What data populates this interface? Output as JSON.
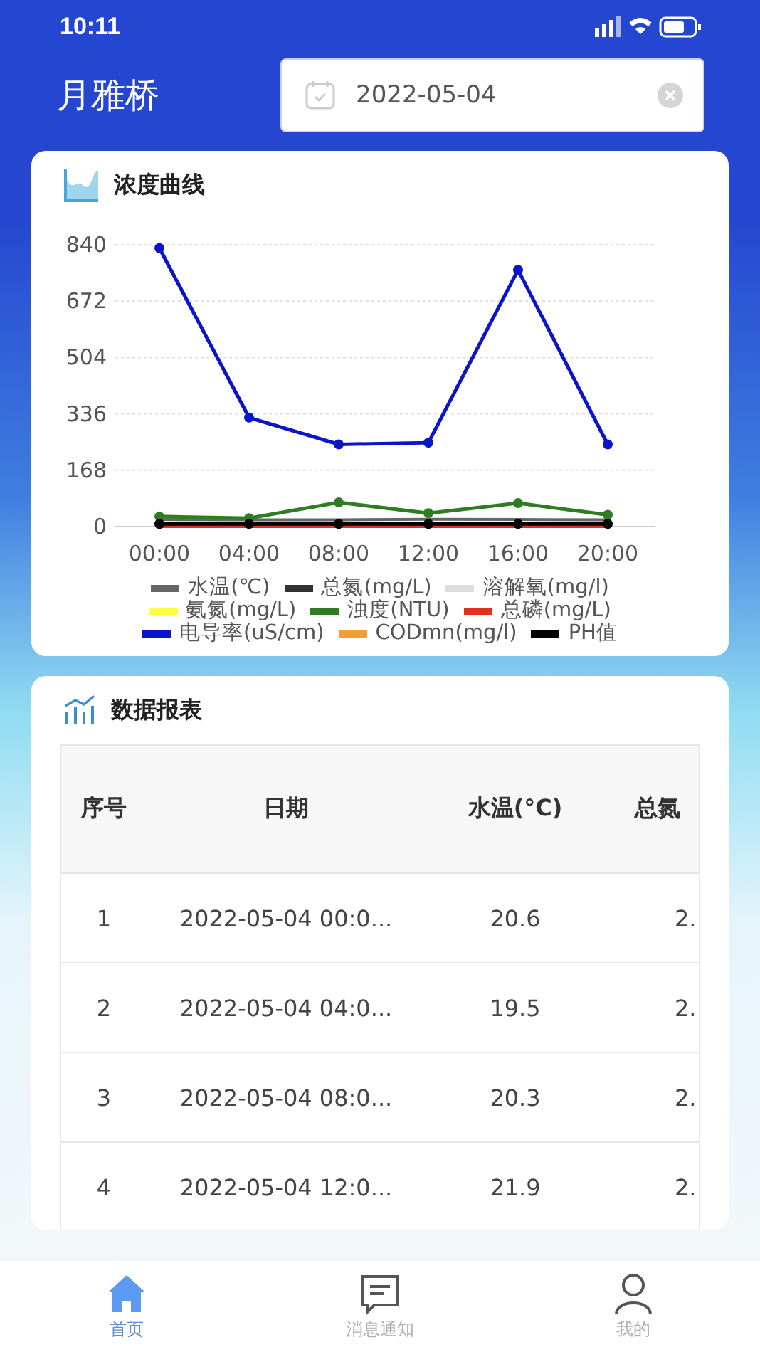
{
  "status_bar": {
    "time": "10:11"
  },
  "header": {
    "title": "月雅桥",
    "date_field": {
      "value": "2022-05-04"
    }
  },
  "chart_card": {
    "title": "浓度曲线",
    "chart_data": {
      "type": "line",
      "categories": [
        "00:00",
        "04:00",
        "08:00",
        "12:00",
        "16:00",
        "20:00"
      ],
      "ylim": [
        0,
        840
      ],
      "yticks": [
        0,
        168,
        336,
        504,
        672,
        840
      ],
      "series": [
        {
          "name": "水温(℃)",
          "color": "#666666",
          "values": [
            21,
            20,
            20,
            22,
            21,
            20
          ]
        },
        {
          "name": "总氮(mg/L)",
          "color": "#333333",
          "values": [
            null,
            null,
            null,
            null,
            null,
            null
          ]
        },
        {
          "name": "溶解氧(mg/l)",
          "color": "#dddddd",
          "values": [
            null,
            null,
            null,
            null,
            null,
            null
          ]
        },
        {
          "name": "氨氮(mg/L)",
          "color": "#ffff44",
          "values": [
            null,
            null,
            null,
            null,
            null,
            null
          ]
        },
        {
          "name": "浊度(NTU)",
          "color": "#2e7d22",
          "values": [
            30,
            25,
            72,
            40,
            70,
            35
          ],
          "marker": "circle"
        },
        {
          "name": "总磷(mg/L)",
          "color": "#e03020",
          "values": [
            0,
            0,
            0,
            0,
            0,
            0
          ]
        },
        {
          "name": "电导率(uS/cm)",
          "color": "#0a14c8",
          "values": [
            830,
            325,
            245,
            250,
            765,
            245
          ],
          "marker": "circle"
        },
        {
          "name": "CODmn(mg/l)",
          "color": "#f0a030",
          "values": [
            null,
            null,
            null,
            null,
            null,
            null
          ]
        },
        {
          "name": "PH值",
          "color": "#000000",
          "values": [
            8,
            8,
            8,
            8,
            8,
            8
          ],
          "marker": "circle"
        }
      ]
    }
  },
  "table_card": {
    "title": "数据报表",
    "columns": [
      "序号",
      "日期",
      "水温(°C)",
      "总氮"
    ],
    "rows": [
      [
        "1",
        "2022-05-04 00:0...",
        "20.6",
        "2."
      ],
      [
        "2",
        "2022-05-04 04:0...",
        "19.5",
        "2."
      ],
      [
        "3",
        "2022-05-04 08:0...",
        "20.3",
        "2."
      ],
      [
        "4",
        "2022-05-04 12:0...",
        "21.9",
        "2."
      ]
    ]
  },
  "tab_bar": [
    {
      "label": "首页",
      "kind": "home",
      "selected": true
    },
    {
      "label": "消息通知",
      "kind": "message",
      "selected": false
    },
    {
      "label": "我的",
      "kind": "user",
      "selected": false
    }
  ]
}
